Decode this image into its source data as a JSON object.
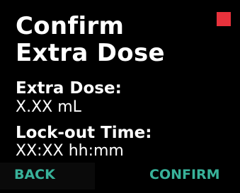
{
  "screen": {
    "title_line1": "Confirm",
    "title_line2": "Extra Dose"
  },
  "status": {
    "indicator_color": "#e8323c"
  },
  "extra_dose": {
    "label": "Extra Dose:",
    "value": "X.XX mL"
  },
  "lockout": {
    "label": "Lock-out Time:",
    "value": "XX:XX hh:mm"
  },
  "softkeys": {
    "back_label": "BACK",
    "confirm_label": "CONFIRM",
    "color": "#38b29a"
  }
}
